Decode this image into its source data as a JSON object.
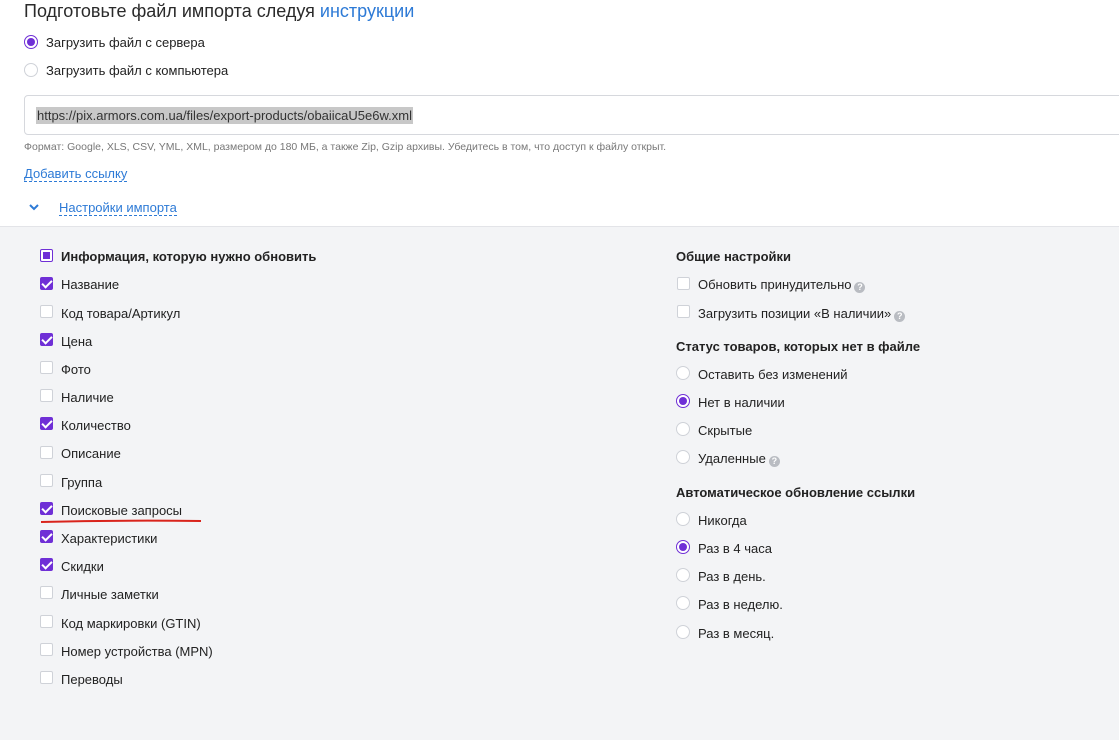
{
  "header": {
    "title_prefix": "Подготовьте файл импорта следуя",
    "title_link": "инструкции"
  },
  "source": {
    "options": [
      {
        "label": "Загрузить файл с сервера",
        "selected": true
      },
      {
        "label": "Загрузить файл с компьютера",
        "selected": false
      }
    ],
    "url_value": "https://pix.armors.com.ua/files/export-products/obaiicaU5e6w.xml",
    "hint": "Формат: Google, XLS, CSV, YML, XML, размером до 180 МБ, а также Zip, Gzip архивы. Убедитесь в том, что доступ к файлу открыт.",
    "add_link": "Добавить ссылку",
    "settings_link": "Настройки импорта"
  },
  "update_info": {
    "title": "Информация, которую нужно обновить",
    "items": [
      {
        "label": "Название",
        "checked": true
      },
      {
        "label": "Код товара/Артикул",
        "checked": false
      },
      {
        "label": "Цена",
        "checked": true
      },
      {
        "label": "Фото",
        "checked": false
      },
      {
        "label": "Наличие",
        "checked": false
      },
      {
        "label": "Количество",
        "checked": true
      },
      {
        "label": "Описание",
        "checked": false
      },
      {
        "label": "Группа",
        "checked": false
      },
      {
        "label": "Поисковые запросы",
        "checked": true
      },
      {
        "label": "Характеристики",
        "checked": true
      },
      {
        "label": "Скидки",
        "checked": true
      },
      {
        "label": "Личные заметки",
        "checked": false
      },
      {
        "label": "Код маркировки (GTIN)",
        "checked": false
      },
      {
        "label": "Номер устройства (MPN)",
        "checked": false
      },
      {
        "label": "Переводы",
        "checked": false
      }
    ]
  },
  "general": {
    "title": "Общие настройки",
    "items": [
      {
        "label": "Обновить принудительно",
        "checked": false
      },
      {
        "label": "Загрузить позиции «В наличии»",
        "checked": false
      }
    ]
  },
  "missing_status": {
    "title": "Статус товаров, которых нет в файле",
    "options": [
      {
        "label": "Оставить без изменений",
        "selected": false
      },
      {
        "label": "Нет в наличии",
        "selected": true
      },
      {
        "label": "Скрытые",
        "selected": false
      },
      {
        "label": "Удаленные",
        "selected": false
      }
    ]
  },
  "auto_update": {
    "title": "Автоматическое обновление ссылки",
    "options": [
      {
        "label": "Никогда",
        "selected": false
      },
      {
        "label": "Раз в 4 часа",
        "selected": true
      },
      {
        "label": "Раз в день.",
        "selected": false
      },
      {
        "label": "Раз в неделю.",
        "selected": false
      },
      {
        "label": "Раз в месяц.",
        "selected": false
      }
    ]
  },
  "help_glyph": "?",
  "colors": {
    "accent": "#6f2fd6",
    "link": "#2d7ad6",
    "annotation": "#d9241c"
  }
}
